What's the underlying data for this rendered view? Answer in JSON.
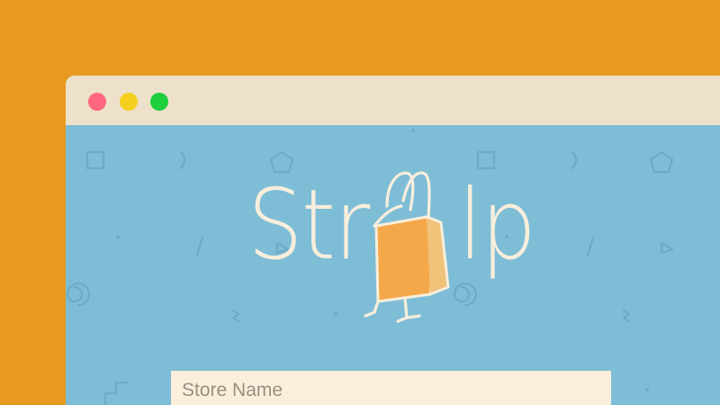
{
  "window": {
    "controls": [
      {
        "name": "close",
        "color": "#FF6680"
      },
      {
        "name": "minimize",
        "color": "#F5CF1E"
      },
      {
        "name": "maximize",
        "color": "#1ECF3E"
      }
    ]
  },
  "logo": {
    "text_left": "Str",
    "text_right": "lp",
    "icon": "shopping-bag-icon",
    "bag_color": "#F5A84A",
    "text_color": "#F8EEDC"
  },
  "store_name_field": {
    "placeholder": "Store Name",
    "value": ""
  },
  "colors": {
    "page_background": "#E89A20",
    "titlebar": "#EDE1C9",
    "content_background": "#7EBDD6",
    "pattern": "#6DA9C2",
    "input_background": "#FBEEDC"
  }
}
